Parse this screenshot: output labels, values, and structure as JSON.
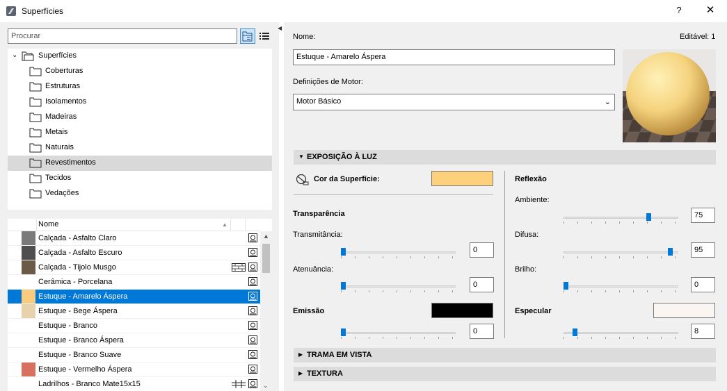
{
  "window": {
    "title": "Superfícies",
    "help": "?",
    "close": "✕"
  },
  "search": {
    "placeholder": "Procurar"
  },
  "tree": {
    "root": "Superfícies",
    "folders": [
      "Coberturas",
      "Estruturas",
      "Isolamentos",
      "Madeiras",
      "Metais",
      "Naturais",
      "Revestimentos",
      "Tecidos",
      "Vedações"
    ],
    "selected": "Revestimentos"
  },
  "list": {
    "column_name": "Nome",
    "rows": [
      {
        "name": "Calçada - Asfalto Claro",
        "color": "#7a7a7a",
        "pattern": ""
      },
      {
        "name": "Calçada - Asfalto Escuro",
        "color": "#4e4e4e",
        "pattern": ""
      },
      {
        "name": "Calçada - Tijolo Musgo",
        "color": "#6b5a46",
        "pattern": "brick"
      },
      {
        "name": "Cerâmica - Porcelana",
        "color": "",
        "pattern": ""
      },
      {
        "name": "Estuque - Amarelo Áspera",
        "color": "#f8cb7d",
        "pattern": "",
        "selected": true
      },
      {
        "name": "Estuque - Bege Áspera",
        "color": "#e8d2ad",
        "pattern": ""
      },
      {
        "name": "Estuque - Branco",
        "color": "",
        "pattern": ""
      },
      {
        "name": "Estuque - Branco Áspera",
        "color": "",
        "pattern": ""
      },
      {
        "name": "Estuque - Branco Suave",
        "color": "",
        "pattern": ""
      },
      {
        "name": "Estuque - Vermelho Áspera",
        "color": "#d9705f",
        "pattern": ""
      },
      {
        "name": "Ladrilhos - Branco Mate15x15",
        "color": "",
        "pattern": "grid"
      }
    ]
  },
  "details": {
    "name_label": "Nome:",
    "editable": "Editável: 1",
    "name_value": "Estuque - Amarelo Áspera",
    "engine_label": "Definições de Motor:",
    "engine_value": "Motor Básico"
  },
  "light": {
    "section_title": "EXPOSIÇÃO À LUZ",
    "surface_color_label": "Cor da Superfície:",
    "surface_color": "#fdd17b",
    "transparency_title": "Transparência",
    "transmittance_label": "Transmitância:",
    "transmittance_value": "0",
    "attenuation_label": "Atenuância:",
    "attenuation_value": "0",
    "emission_label": "Emissão",
    "emission_color": "#000000",
    "emission_value": "0",
    "reflection_title": "Reflexão",
    "ambient_label": "Ambiente:",
    "ambient_value": "75",
    "diffuse_label": "Difusa:",
    "diffuse_value": "95",
    "shine_label": "Brilho:",
    "shine_value": "0",
    "specular_label": "Especular",
    "specular_color": "#fbf5f1",
    "specular_value": "8"
  },
  "sections": {
    "trama": "TRAMA EM VISTA",
    "textura": "TEXTURA"
  },
  "colors": {
    "accent": "#0078d7",
    "panel": "#f0f0f0",
    "section": "#dcdcdc"
  }
}
